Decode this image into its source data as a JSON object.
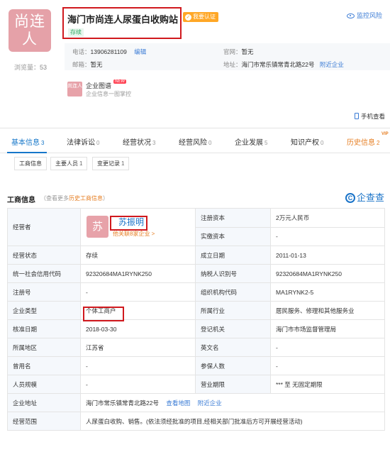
{
  "header": {
    "logo_text": "尚连人",
    "views_label": "浏览量：",
    "views_count": "53",
    "company_name": "海门市尚连人尿蛋白收购站",
    "auth_badge": "我要认证",
    "status_tag": "存续",
    "monitor_label": "监控风险"
  },
  "contact": {
    "phone_label": "电话：",
    "phone": "13906281109",
    "edit_label": "编辑",
    "website_label": "官网：",
    "website": "暂无",
    "email_label": "邮箱：",
    "email": "暂无",
    "address_label": "地址：",
    "address": "海门市常乐镇常青北路22号",
    "nearby_label": "附近企业"
  },
  "graph": {
    "icon_text": "尚连人",
    "title": "企业图谱",
    "new_badge": "NEW",
    "subtitle": "企业信息一图掌控"
  },
  "mobile_label": "手机查看",
  "tabs": [
    {
      "label": "基本信息",
      "count": "3"
    },
    {
      "label": "法律诉讼",
      "count": "0"
    },
    {
      "label": "经营状况",
      "count": "3"
    },
    {
      "label": "经营风险",
      "count": "0"
    },
    {
      "label": "企业发展",
      "count": "5"
    },
    {
      "label": "知识产权",
      "count": "0"
    },
    {
      "label": "历史信息",
      "count": "2"
    }
  ],
  "vip_badge": "VIP",
  "subtabs": [
    {
      "label": "工商信息",
      "count": ""
    },
    {
      "label": "主要人员",
      "count": "1"
    },
    {
      "label": "变更记录",
      "count": "1"
    }
  ],
  "section": {
    "title": "工商信息",
    "note_prefix": "（查看更多",
    "note_link": "历史工商信息",
    "note_suffix": "）",
    "brand_c": "C",
    "brand": "企查查"
  },
  "business": {
    "operator_label": "经营者",
    "avatar_text": "苏",
    "operator_name": "苏振明",
    "operator_link": "他关联8家企业 >",
    "capital_label": "注册资本",
    "capital": "2万元人民币",
    "paid_label": "实缴资本",
    "paid": "-",
    "status_label": "经营状态",
    "status": "存续",
    "founded_label": "成立日期",
    "founded": "2011-01-13",
    "credit_code_label": "统一社会信用代码",
    "credit_code": "92320684MA1RYNK250",
    "taxpayer_label": "纳税人识别号",
    "taxpayer": "92320684MA1RYNK250",
    "reg_no_label": "注册号",
    "reg_no": "-",
    "org_code_label": "组织机构代码",
    "org_code": "MA1RYNK2-5",
    "type_label": "企业类型",
    "type": "个体工商户",
    "industry_label": "所属行业",
    "industry": "居民服务、修理和其他服务业",
    "approval_label": "核准日期",
    "approval": "2018-03-30",
    "authority_label": "登记机关",
    "authority": "海门市市场监督管理局",
    "region_label": "所属地区",
    "region": "江苏省",
    "english_label": "英文名",
    "english": "-",
    "former_label": "曾用名",
    "former": "-",
    "insured_label": "参保人数",
    "insured": "-",
    "staff_label": "人员规模",
    "staff": "-",
    "term_label": "营业期限",
    "term": "*** 至 无固定期限",
    "address_label": "企业地址",
    "address": "海门市常乐镇常青北路22号",
    "map_link": "查看地图",
    "nearby_link": "附近企业",
    "scope_label": "经营范围",
    "scope": "人尿蛋白收购、销售。(依法须经批准的项目,经相关部门批准后方可开展经营活动)"
  }
}
